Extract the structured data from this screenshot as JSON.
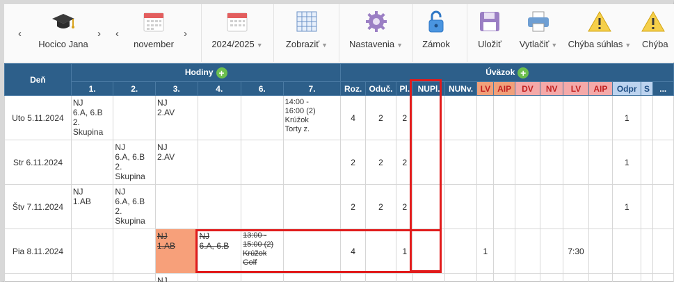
{
  "toolbar": {
    "teacher": {
      "label": "Hocico Jana"
    },
    "month": {
      "label": "november"
    },
    "year": {
      "label": "2024/2025"
    },
    "view": {
      "label": "Zobraziť"
    },
    "settings": {
      "label": "Nastavenia"
    },
    "lock": {
      "label": "Zámok"
    },
    "save": {
      "label": "Uložiť"
    },
    "print": {
      "label": "Vytlačiť"
    },
    "missing_consent": {
      "label": "Chýba súhlas"
    },
    "missing": {
      "label": "Chýba"
    }
  },
  "table": {
    "day_header": "Deň",
    "hours_group": "Hodiny",
    "load_group": "Úväzok",
    "hour_columns": [
      "1.",
      "2.",
      "3.",
      "4.",
      "6.",
      "7."
    ],
    "load_columns": [
      "Roz.",
      "Oduč.",
      "Pl.",
      "NUPl.",
      "NUNv.",
      "LV",
      "AIP",
      "DV",
      "NV",
      "LV",
      "AIP",
      "Odpr",
      "S",
      "..."
    ],
    "load_column_colors": [
      "#2d5f8a",
      "#2d5f8a",
      "#2d5f8a",
      "#2d5f8a",
      "#2d5f8a",
      "#f0a07a",
      "#f0a07a",
      "#f4a9a9",
      "#f4a9a9",
      "#f4a9a9",
      "#f4a9a9",
      "#bcd3ef",
      "#bcd3ef",
      "#2d5f8a"
    ],
    "rows": [
      {
        "day": "Uto 5.11.2024",
        "hours": [
          [
            "NJ",
            "6.A, 6.B",
            "2.",
            "Skupina"
          ],
          [],
          [
            "NJ",
            "2.AV"
          ],
          [],
          [],
          [
            "14:00 -",
            "16:00 (2)",
            "Krúžok",
            "Torty z."
          ]
        ],
        "loads": [
          "4",
          "2",
          "2",
          "",
          "",
          "",
          "",
          "",
          "",
          "",
          "",
          "1",
          "",
          ""
        ]
      },
      {
        "day": "Str 6.11.2024",
        "hours": [
          [],
          [
            "NJ",
            "6.A, 6.B",
            "2.",
            "Skupina"
          ],
          [
            "NJ",
            "2.AV"
          ],
          [],
          [],
          []
        ],
        "loads": [
          "2",
          "2",
          "2",
          "",
          "",
          "",
          "",
          "",
          "",
          "",
          "",
          "1",
          "",
          ""
        ]
      },
      {
        "day": "Štv 7.11.2024",
        "hours": [
          [
            "NJ",
            "1.AB"
          ],
          [
            "NJ",
            "6.A, 6.B",
            "2.",
            "Skupina"
          ],
          [],
          [],
          [],
          []
        ],
        "loads": [
          "2",
          "2",
          "2",
          "",
          "",
          "",
          "",
          "",
          "",
          "",
          "",
          "1",
          "",
          ""
        ]
      },
      {
        "day": "Pia 8.11.2024",
        "hours": [
          [],
          [],
          [
            "NJ",
            "1.AB"
          ],
          [
            "NJ",
            "6.A, 6.B"
          ],
          [
            "13:00 -",
            "15:00 (2)",
            "Krúžok",
            "Golf"
          ],
          []
        ],
        "loads": [
          "4",
          "",
          "1",
          "",
          "",
          "1",
          "",
          "",
          "",
          "7:30",
          "",
          "",
          "",
          ""
        ]
      },
      {
        "day": "",
        "hours": [
          [],
          [],
          [
            "NJ"
          ],
          [],
          [],
          []
        ],
        "loads": [
          "",
          "",
          "",
          "",
          "",
          "",
          "",
          "",
          "",
          "",
          "",
          "",
          "",
          ""
        ]
      }
    ]
  }
}
